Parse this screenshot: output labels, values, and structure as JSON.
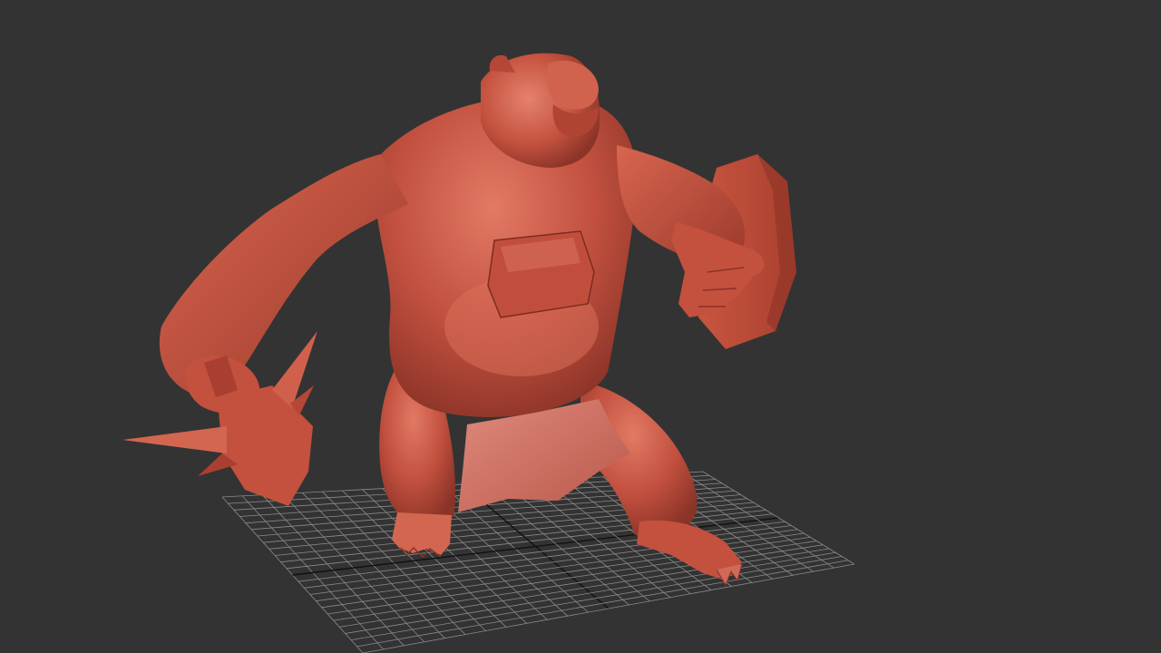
{
  "viewport": {
    "background_color": "#333333",
    "grid_color": "#8a8a8a",
    "grid_axis_color": "#111111",
    "model_color": "#c2503f",
    "model_highlight_color": "#e07a66",
    "model_shadow_color": "#7a2a20",
    "cloth_color": "#d67a6c"
  }
}
